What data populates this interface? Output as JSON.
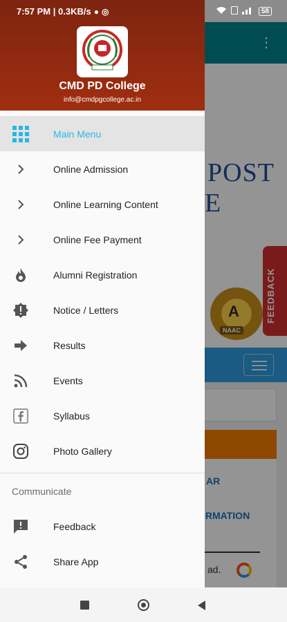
{
  "status_bar": {
    "time_speed": "7:57 PM | 0.3KB/s",
    "battery": "58"
  },
  "header": {
    "college_name": "CMD PD College",
    "email": "info@cmdpgcollege.ac.in"
  },
  "menu": {
    "items": [
      {
        "label": "Main Menu",
        "icon": "grid-icon",
        "active": true
      },
      {
        "label": "Online Admission",
        "icon": "chevron-right-icon"
      },
      {
        "label": "Online Learning Content",
        "icon": "chevron-right-icon"
      },
      {
        "label": "Online Fee Payment",
        "icon": "chevron-right-icon"
      },
      {
        "label": "Alumni Registration",
        "icon": "flame-icon"
      },
      {
        "label": "Notice / Letters",
        "icon": "alert-badge-icon"
      },
      {
        "label": "Results",
        "icon": "arrow-right-icon"
      },
      {
        "label": "Events",
        "icon": "rss-icon"
      },
      {
        "label": "Syllabus",
        "icon": "facebook-icon"
      },
      {
        "label": "Photo Gallery",
        "icon": "instagram-icon"
      }
    ]
  },
  "communicate": {
    "title": "Communicate",
    "items": [
      {
        "label": "Feedback",
        "icon": "feedback-icon"
      },
      {
        "label": "Share App",
        "icon": "share-icon"
      }
    ]
  },
  "background": {
    "hero_line1": "POST",
    "hero_line2": "E",
    "naac_letter": "A",
    "naac_label": "NAAC",
    "feedback_tab": "FEEDBACK",
    "link1": "AR",
    "link2": "ORMATION",
    "ad_text": "ad."
  },
  "colors": {
    "header_red": "#8a2810",
    "active_accent": "#29b6e6",
    "toolbar_teal": "#00838f"
  }
}
